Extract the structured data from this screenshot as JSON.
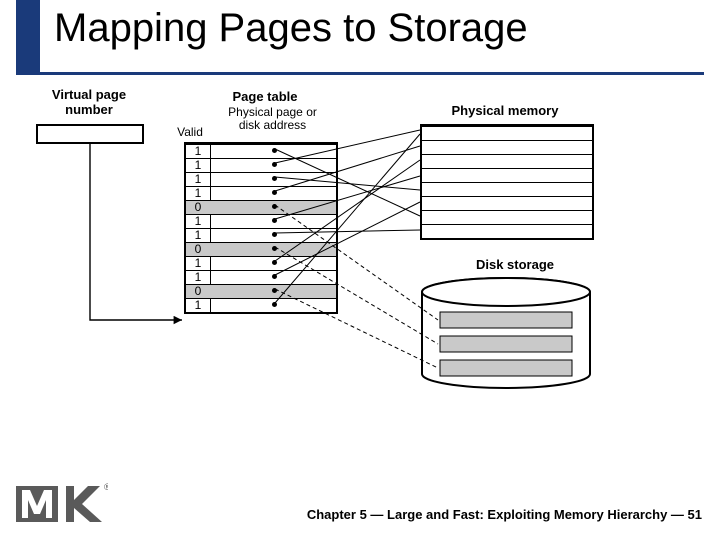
{
  "title": "Mapping Pages to Storage",
  "labels": {
    "vpn": "Virtual page\nnumber",
    "pagetable": "Page table",
    "ppda": "Physical page or\ndisk address",
    "valid": "Valid",
    "pm": "Physical memory",
    "disk": "Disk storage"
  },
  "page_table": {
    "valid_bits": [
      "1",
      "1",
      "1",
      "1",
      "0",
      "1",
      "1",
      "0",
      "1",
      "1",
      "0",
      "1"
    ]
  },
  "footer": "Chapter 5 — Large and Fast: Exploiting Memory Hierarchy — 51",
  "logo_tm": "®"
}
